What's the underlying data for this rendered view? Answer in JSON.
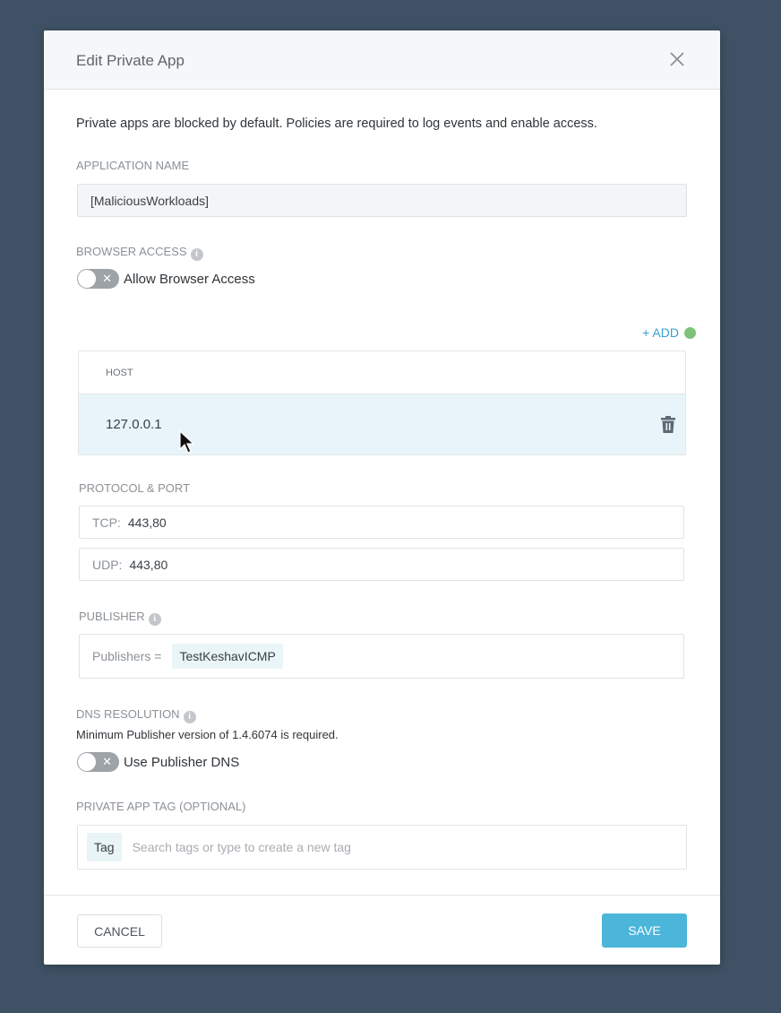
{
  "modal": {
    "title": "Edit Private App",
    "close_icon": "close-icon",
    "intro": "Private apps are blocked by default. Policies are required to log events and enable access."
  },
  "application_name": {
    "label": "APPLICATION NAME",
    "value": "[MaliciousWorkloads]"
  },
  "browser_access": {
    "label": "BROWSER ACCESS",
    "info_icon": "info-icon",
    "toggle_label": "Allow Browser Access",
    "enabled": false
  },
  "hosts": {
    "add_label": "+ ADD",
    "column_header": "HOST",
    "rows": [
      {
        "host": "127.0.0.1",
        "action_icon": "trash-icon"
      }
    ]
  },
  "protocol_port": {
    "label": "PROTOCOL & PORT",
    "tcp": {
      "prefix": "TCP:",
      "value": "443,80"
    },
    "udp": {
      "prefix": "UDP:",
      "value": "443,80"
    }
  },
  "publisher": {
    "label": "PUBLISHER",
    "info_icon": "info-icon",
    "prefix": "Publishers =",
    "selected": [
      "TestKeshavICMP"
    ]
  },
  "dns_resolution": {
    "label": "DNS RESOLUTION",
    "info_icon": "info-icon",
    "helper": "Minimum Publisher version of 1.4.6074 is required.",
    "toggle_label": "Use Publisher DNS",
    "enabled": false
  },
  "tag": {
    "label": "PRIVATE APP TAG (OPTIONAL)",
    "chip": "Tag",
    "placeholder": "Search tags or type to create a new tag"
  },
  "footer": {
    "cancel_label": "CANCEL",
    "save_label": "SAVE"
  },
  "colors": {
    "backdrop": "#3f5164",
    "accent": "#4cb5da",
    "link": "#3b9ed1",
    "status_dot": "#7ec27a",
    "row_highlight": "#e8f4f9"
  }
}
